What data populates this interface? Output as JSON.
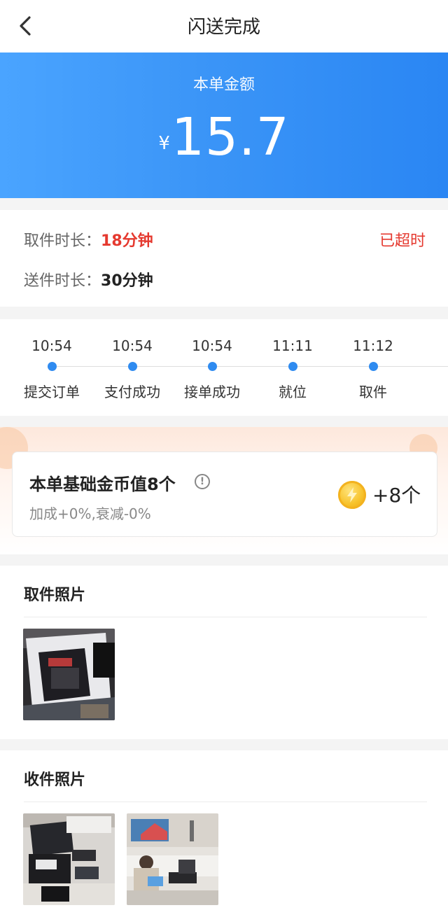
{
  "header": {
    "title": "闪送完成",
    "back_icon": "chevron-left-icon"
  },
  "amount": {
    "label": "本单金额",
    "currency": "¥",
    "value": "15.7"
  },
  "duration": {
    "pickup_label": "取件时长：",
    "pickup_value": "18分钟",
    "delivery_label": "送件时长：",
    "delivery_value": "30分钟",
    "status": "已超时"
  },
  "timeline": [
    {
      "time": "10:54",
      "label": "提交订单"
    },
    {
      "time": "10:54",
      "label": "支付成功"
    },
    {
      "time": "10:54",
      "label": "接单成功"
    },
    {
      "time": "11:11",
      "label": "就位"
    },
    {
      "time": "11:12",
      "label": "取件"
    }
  ],
  "coins": {
    "title": "本单基础金币值8个",
    "info_icon": "!",
    "subtitle": "加成+0%,衰减-0%",
    "count": "+8个"
  },
  "pickup_photos": {
    "title": "取件照片"
  },
  "receive_photos": {
    "title": "收件照片"
  },
  "colors": {
    "accent_blue": "#2f8bf0",
    "alert_red": "#e5392f",
    "coin_gold": "#f7c22b"
  }
}
